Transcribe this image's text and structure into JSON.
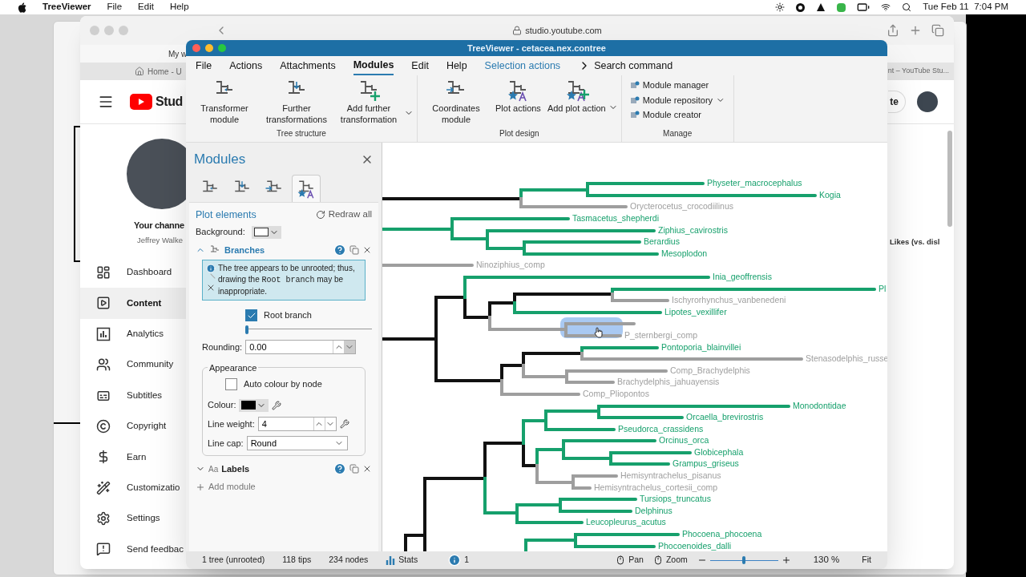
{
  "menubar": {
    "app": "TreeViewer",
    "menus": [
      "File",
      "Edit",
      "Help"
    ],
    "clock": "Tue Feb 11  7:04 PM"
  },
  "browser": {
    "url": "studio.youtube.com",
    "bookmark": "My w",
    "tabs": [
      "Home - U",
      "nt – YouTube Stu..."
    ],
    "brand": "Stud",
    "create": "te",
    "channel": {
      "title": "Your channe",
      "name": "Jeffrey Walke"
    },
    "nav": [
      {
        "kind": "dashboard",
        "label": "Dashboard",
        "selected": false
      },
      {
        "kind": "content",
        "label": "Content",
        "selected": true
      },
      {
        "kind": "analytics",
        "label": "Analytics",
        "selected": false
      },
      {
        "kind": "community",
        "label": "Community",
        "selected": false
      },
      {
        "kind": "subtitles",
        "label": "Subtitles",
        "selected": false
      },
      {
        "kind": "copyright",
        "label": "Copyright",
        "selected": false
      },
      {
        "kind": "earn",
        "label": "Earn",
        "selected": false
      },
      {
        "kind": "customization",
        "label": "Customizatio",
        "selected": false
      },
      {
        "kind": "settings",
        "label": "Settings",
        "selected": false
      },
      {
        "kind": "feedback",
        "label": "Send feedbac",
        "selected": false
      }
    ],
    "column_header": "Likes (vs. disl"
  },
  "app": {
    "title": "TreeViewer - cetacea.nex.contree",
    "menu": [
      {
        "label": "File",
        "selected": false
      },
      {
        "label": "Actions",
        "selected": false
      },
      {
        "label": "Attachments",
        "selected": false
      },
      {
        "label": "Modules",
        "selected": true
      },
      {
        "label": "Edit",
        "selected": false
      },
      {
        "label": "Help",
        "selected": false
      }
    ],
    "selection_actions": "Selection actions",
    "search": "Search command",
    "ribbon": [
      {
        "group": "Tree structure",
        "buttons": [
          {
            "kind": "transform",
            "label": "Transformer module",
            "dropdown": false
          },
          {
            "kind": "further",
            "label": "Further transformations",
            "dropdown": false
          },
          {
            "kind": "add",
            "label": "Add further transformation",
            "dropdown": true
          }
        ]
      },
      {
        "group": "Plot design",
        "buttons": [
          {
            "kind": "coords",
            "label": "Coordinates module",
            "dropdown": false
          },
          {
            "kind": "plot",
            "label": "Plot actions",
            "dropdown": false
          },
          {
            "kind": "addplot",
            "label": "Add plot action",
            "dropdown": true
          }
        ]
      }
    ],
    "manage": {
      "group": "Manage",
      "items": [
        {
          "label": "Module manager",
          "dropdown": false
        },
        {
          "label": "Module repository",
          "dropdown": true
        },
        {
          "label": "Module creator",
          "dropdown": false
        }
      ]
    },
    "panel": {
      "title": "Modules",
      "tabs": [
        {
          "kind": "transform",
          "selected": false
        },
        {
          "kind": "further",
          "selected": false
        },
        {
          "kind": "coords",
          "selected": false
        },
        {
          "kind": "plot",
          "selected": true
        }
      ],
      "section": "Plot elements",
      "redraw": "Redraw all",
      "background_label": "Background:",
      "branches": {
        "title": "Branches",
        "expanded": true,
        "warning": {
          "before": "The tree appears to be unrooted; thus, drawing the",
          "code": "Root branch",
          "after": "may be inappropriate."
        },
        "root_branch": {
          "label": "Root branch",
          "checked": true,
          "level": 0
        },
        "rounding": {
          "label": "Rounding:",
          "value": "0.00"
        },
        "appearance": {
          "title": "Appearance",
          "auto_colour": {
            "label": "Auto colour by node",
            "checked": false
          },
          "colour_label": "Colour:",
          "line_weight": {
            "label": "Line weight:",
            "value": "4"
          },
          "line_cap": {
            "label": "Line cap:",
            "value": "Round"
          }
        }
      },
      "labels": {
        "prefix": "Aa",
        "title": "Labels",
        "expanded": false
      },
      "add_module": "Add module"
    },
    "tree": {
      "tips": [
        {
          "label": "Physeter_macrocephalus",
          "color": "#16a06c"
        },
        {
          "label": "Kogia",
          "color": "#16a06c"
        },
        {
          "label": "Orycterocetus_crocodiilinus",
          "color": "#9e9e9e"
        },
        {
          "label": "Tasmacetus_shepherdi",
          "color": "#16a06c"
        },
        {
          "label": "Ziphius_cavirostris",
          "color": "#16a06c"
        },
        {
          "label": "Berardius",
          "color": "#16a06c"
        },
        {
          "label": "Mesoplodon",
          "color": "#16a06c"
        },
        {
          "label": "Ninoziphius_comp",
          "color": "#9e9e9e"
        },
        {
          "label": "Inia_geoffrensis",
          "color": "#16a06c"
        },
        {
          "label": "Pl",
          "color": "#16a06c"
        },
        {
          "label": "Ischyrorhynchus_vanbenedeni",
          "color": "#9e9e9e"
        },
        {
          "label": "Lipotes_vexillifer",
          "color": "#16a06c"
        },
        {
          "color": "#9e9e9e",
          "selected": true
        },
        {
          "label": "P_sternbergi_comp",
          "color": "#9e9e9e"
        },
        {
          "label": "Pontoporia_blainvillei",
          "color": "#16a06c"
        },
        {
          "label": "Stenasodelphis_russe",
          "color": "#9e9e9e"
        },
        {
          "label": "Comp_Brachydelphis",
          "color": "#9e9e9e"
        },
        {
          "label": "Brachydelphis_jahuayensis",
          "color": "#9e9e9e"
        },
        {
          "label": "Comp_Pliopontos",
          "color": "#9e9e9e"
        },
        {
          "label": "Monodontidae",
          "color": "#16a06c"
        },
        {
          "label": "Orcaella_brevirostris",
          "color": "#16a06c"
        },
        {
          "label": "Pseudorca_crassidens",
          "color": "#16a06c"
        },
        {
          "label": "Orcinus_orca",
          "color": "#16a06c"
        },
        {
          "label": "Globicephala",
          "color": "#16a06c"
        },
        {
          "label": "Grampus_griseus",
          "color": "#16a06c"
        },
        {
          "label": "Hemisyntrachelus_pisanus",
          "color": "#9e9e9e"
        },
        {
          "label": "Hemisyntrachelus_cortesii_comp",
          "color": "#9e9e9e"
        },
        {
          "label": "Tursiops_truncatus",
          "color": "#16a06c"
        },
        {
          "label": "Delphinus",
          "color": "#16a06c"
        },
        {
          "label": "Leucopleurus_acutus",
          "color": "#16a06c"
        },
        {
          "label": "Phocoena_phocoena",
          "color": "#16a06c"
        },
        {
          "label": "Phocoenoides_dalli",
          "color": "#16a06c"
        }
      ]
    },
    "status": {
      "trees": "1 tree (unrooted)",
      "tips": "118 tips",
      "nodes": "234 nodes",
      "stats": "Stats",
      "info": "1",
      "pan": "Pan",
      "zoom": "Zoom",
      "zoom_slider": {
        "level": 0.5
      },
      "zoom_value": "130 %",
      "fit": "Fit"
    }
  }
}
